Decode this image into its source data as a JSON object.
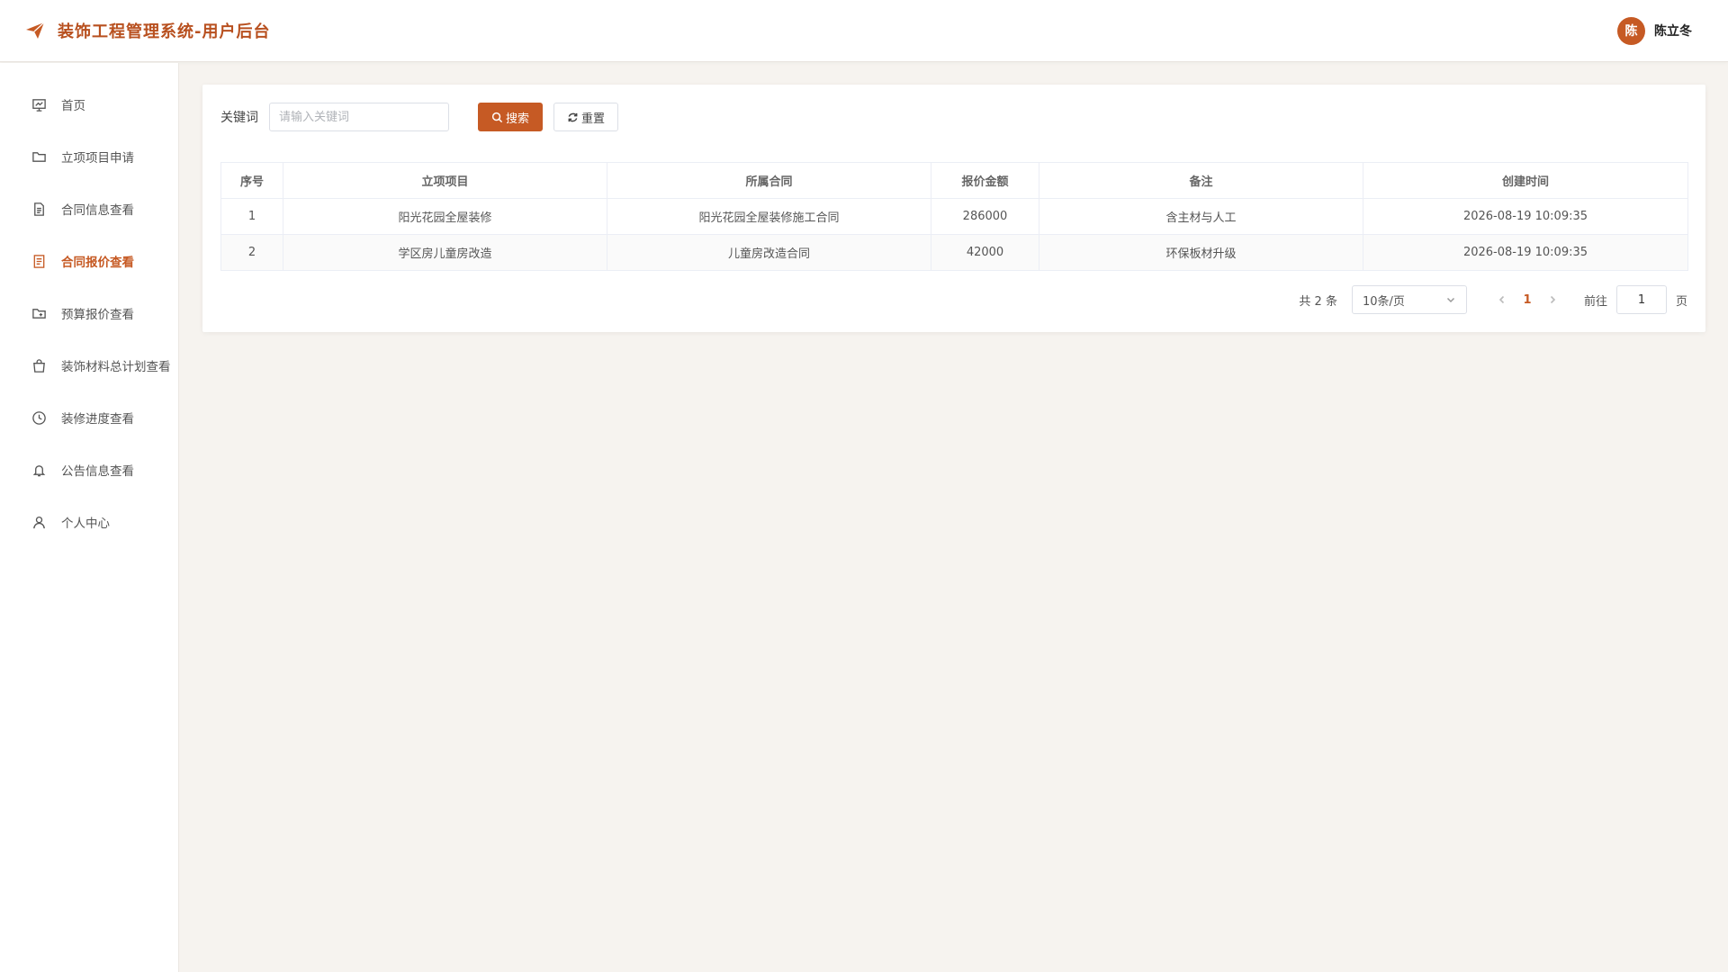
{
  "app": {
    "title": "装饰工程管理系统-用户后台"
  },
  "user": {
    "avatar_text": "陈",
    "name": "陈立冬"
  },
  "sidebar": {
    "items": [
      {
        "label": "首页",
        "icon": "chart-board-icon"
      },
      {
        "label": "立项项目申请",
        "icon": "folder-icon"
      },
      {
        "label": "合同信息查看",
        "icon": "document-icon"
      },
      {
        "label": "合同报价查看",
        "icon": "list-document-icon",
        "active": true
      },
      {
        "label": "预算报价查看",
        "icon": "folder-add-icon"
      },
      {
        "label": "装饰材料总计划查看",
        "icon": "shopping-bag-icon"
      },
      {
        "label": "装修进度查看",
        "icon": "clock-icon"
      },
      {
        "label": "公告信息查看",
        "icon": "bell-icon"
      },
      {
        "label": "个人中心",
        "icon": "user-icon"
      }
    ]
  },
  "search": {
    "label": "关键词",
    "placeholder": "请输入关键词",
    "value": "",
    "search_button": "搜索",
    "reset_button": "重置"
  },
  "table": {
    "columns": [
      "序号",
      "立项项目",
      "所属合同",
      "报价金额",
      "备注",
      "创建时间"
    ],
    "rows": [
      [
        "1",
        "阳光花园全屋装修",
        "阳光花园全屋装修施工合同",
        "286000",
        "含主材与人工",
        "2026-08-19 10:09:35"
      ],
      [
        "2",
        "学区房儿童房改造",
        "儿童房改造合同",
        "42000",
        "环保板材升级",
        "2026-08-19 10:09:35"
      ]
    ]
  },
  "pagination": {
    "total_text": "共 2 条",
    "page_size": "10条/页",
    "current_page": "1",
    "goto_label": "前往",
    "goto_value": "1",
    "page_suffix": "页"
  },
  "colors": {
    "accent": "#c65a24",
    "brand_text": "#b8501f",
    "background": "#f6f3ef"
  }
}
